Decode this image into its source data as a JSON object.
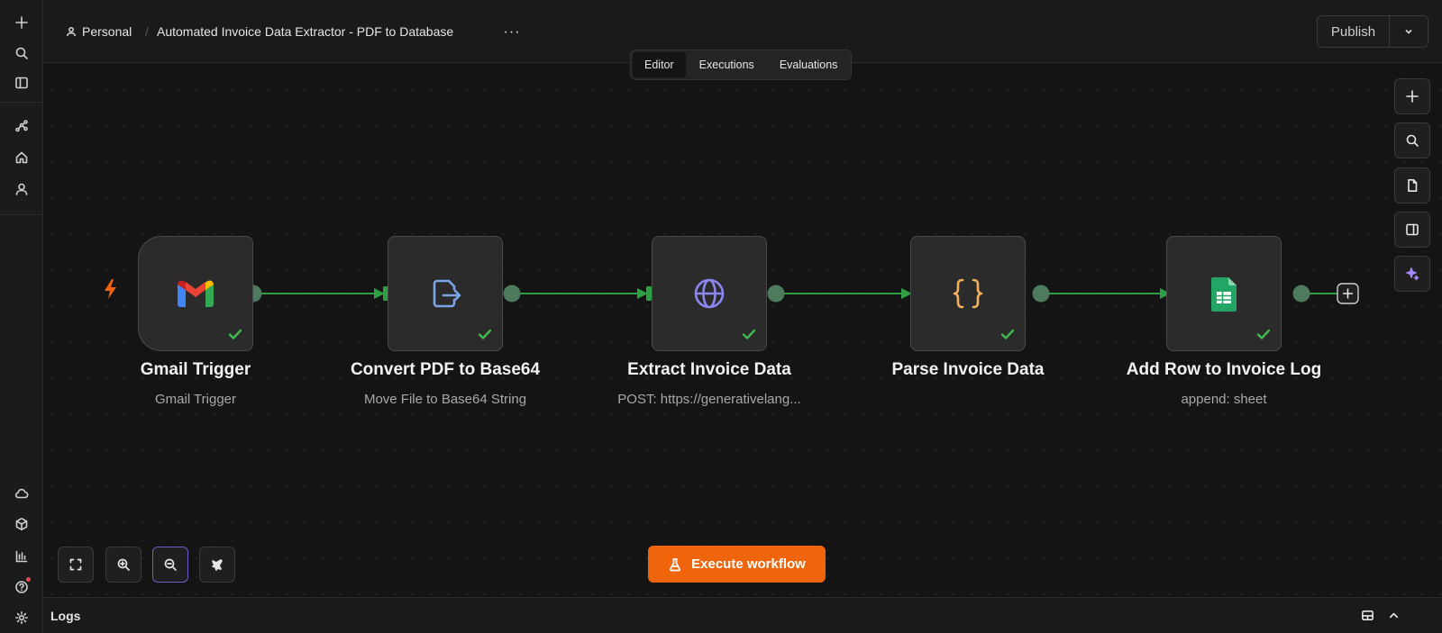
{
  "header": {
    "project": "Personal",
    "workflow_title": "Automated Invoice Data Extractor - PDF to Database",
    "more_label": "···",
    "publish_label": "Publish"
  },
  "tabs": [
    {
      "label": "Editor",
      "active": true
    },
    {
      "label": "Executions",
      "active": false
    },
    {
      "label": "Evaluations",
      "active": false
    }
  ],
  "nodes": [
    {
      "title": "Gmail Trigger",
      "subtitle": "Gmail Trigger",
      "icon": "gmail-icon",
      "status": "success"
    },
    {
      "title": "Convert PDF to Base64",
      "subtitle": "Move File to Base64 String",
      "icon": "file-export-icon",
      "status": "success"
    },
    {
      "title": "Extract Invoice Data",
      "subtitle": "POST: https://generativelang...",
      "icon": "globe-icon",
      "status": "success"
    },
    {
      "title": "Parse Invoice Data",
      "subtitle": "",
      "icon": "code-braces-icon",
      "status": "success"
    },
    {
      "title": "Add Row to Invoice Log",
      "subtitle": "append: sheet",
      "icon": "google-sheets-icon",
      "status": "success"
    }
  ],
  "canvas": {
    "execute_label": "Execute workflow"
  },
  "logs": {
    "label": "Logs"
  },
  "colors": {
    "accent": "#f0650c",
    "connection": "#2ea043",
    "success": "#3fb950"
  }
}
